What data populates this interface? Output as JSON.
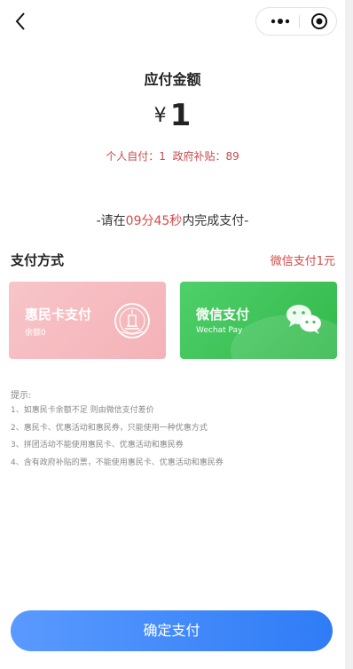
{
  "nav": {},
  "amount": {
    "title": "应付金额",
    "currency_symbol": "¥",
    "value": "1",
    "breakdown": "个人自付：1  政府补贴：89"
  },
  "countdown": {
    "prefix": "-请在",
    "time": "09分45秒",
    "suffix": "内完成支付-"
  },
  "payment": {
    "section_title": "支付方式",
    "selected_summary": "微信支付1元",
    "methods": [
      {
        "name": "惠民卡支付",
        "sub": "余额0",
        "icon": "huimin-card-logo-icon",
        "color": "#f6bcc1"
      },
      {
        "name": "微信支付",
        "sub": "Wechat Pay",
        "icon": "wechat-icon",
        "color": "#3fc356"
      }
    ]
  },
  "tips": {
    "title": "提示:",
    "items": [
      "1、如惠民卡余额不足 则由微信支付差价",
      "2、惠民卡、优惠活动和惠民券，只能使用一种优惠方式",
      "3、拼团活动不能使用惠民卡、优惠活动和惠民券",
      "4、含有政府补贴的票，不能使用惠民卡、优惠活动和惠民券"
    ]
  },
  "confirm_label": "确定支付",
  "colors": {
    "accent_red": "#d84848",
    "button_blue": "#2f7cf6",
    "wechat_green": "#3fc356"
  }
}
